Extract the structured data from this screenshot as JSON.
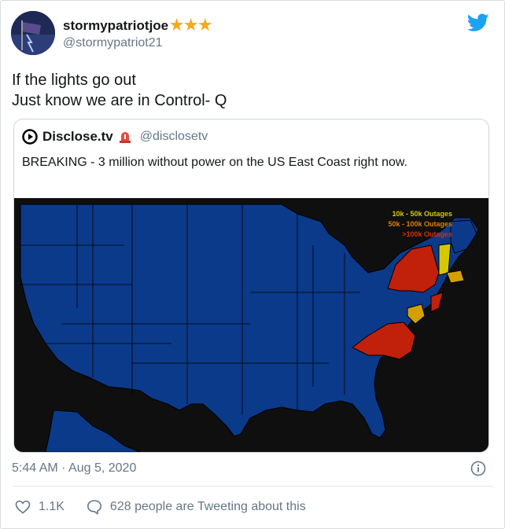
{
  "user": {
    "display_name": "stormypatriotjoe",
    "name_suffix": "★★★",
    "handle": "@stormypatriot21",
    "avatar_icon": "flag-lightning-avatar"
  },
  "tweet": {
    "line1": "If the lights go out",
    "line2": "Just know we are in Control- Q"
  },
  "quote": {
    "account_name": "Disclose.tv",
    "badge_icon": "siren-icon",
    "handle": "@disclosetv",
    "text": "BREAKING - 3 million without power on the US East Coast right now.",
    "map": {
      "legend": [
        "10k - 50k Outages",
        "50k - 100k Outages",
        ">100k Outages"
      ],
      "colors": {
        "land": "#0b3a8a",
        "outage_low": "#d4c900",
        "outage_mid": "#d4a000",
        "outage_high": "#c1200b",
        "background": "#0f0f0f"
      }
    }
  },
  "meta": {
    "timestamp": "5:44 AM · Aug 5, 2020"
  },
  "actions": {
    "likes": "1.1K",
    "tweeting": "628 people are Tweeting about this"
  },
  "colors": {
    "brand": "#1da1f2",
    "muted": "#657786",
    "star": "#f2a91d"
  }
}
